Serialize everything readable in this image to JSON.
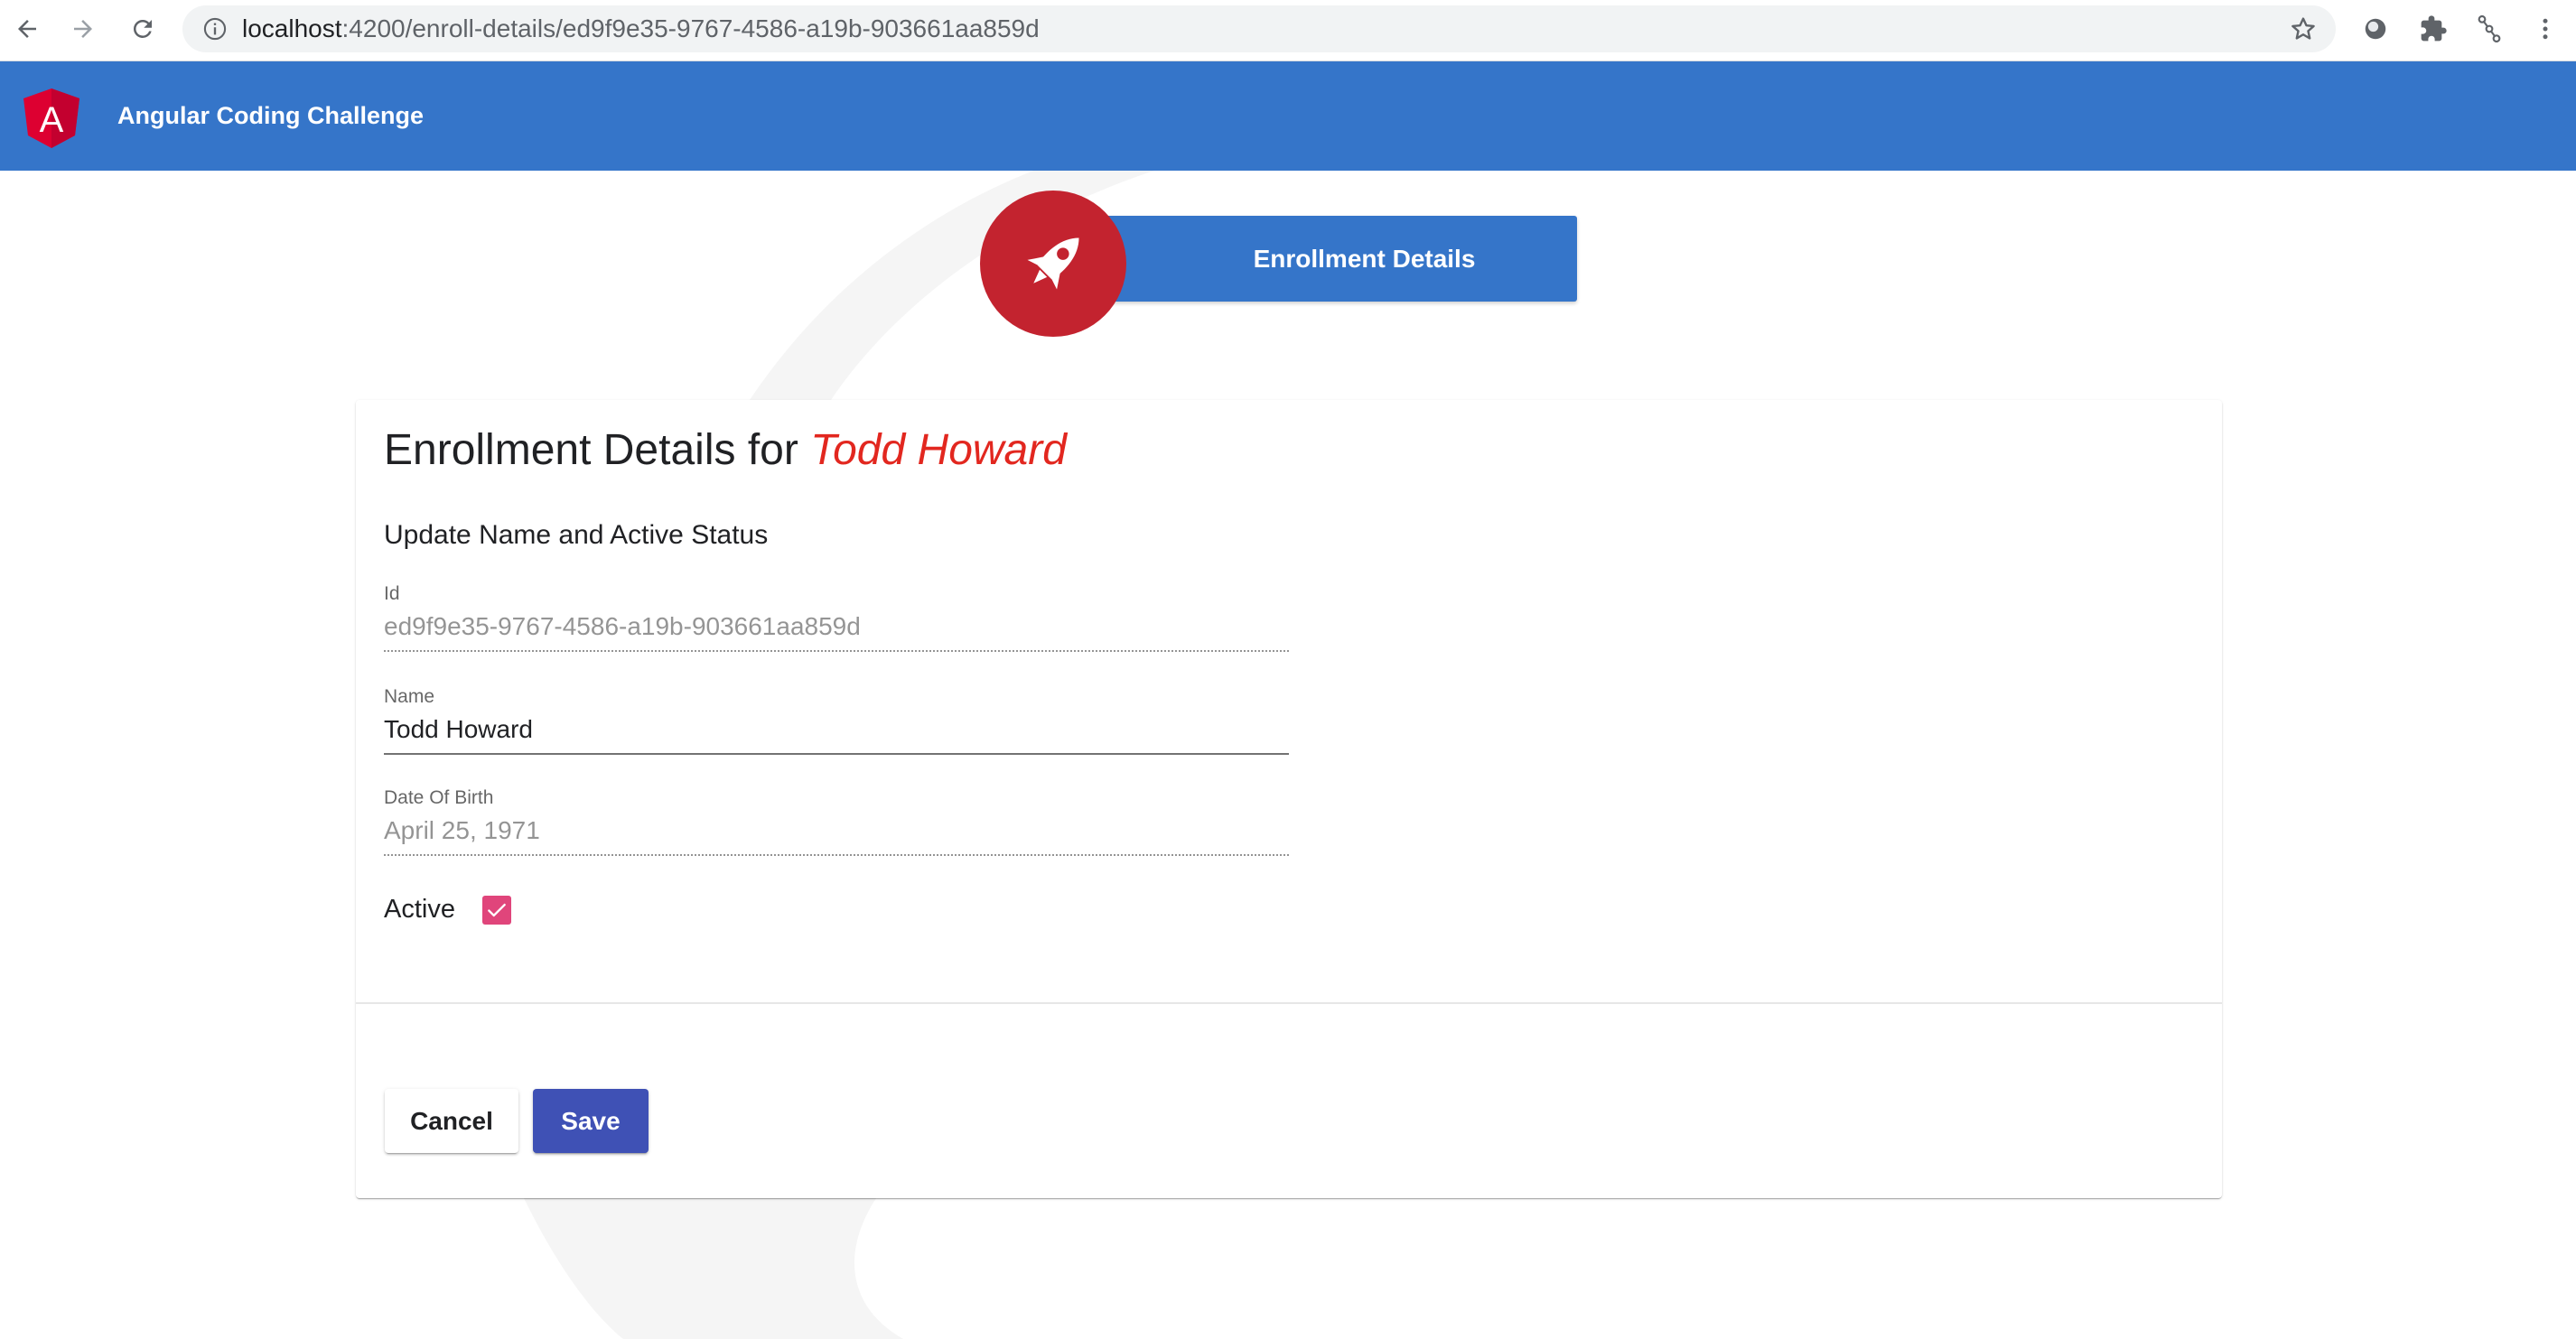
{
  "browser": {
    "url_host": "localhost",
    "url_path": ":4200/enroll-details/ed9f9e35-9767-4586-a19b-903661aa859d",
    "icons": [
      "back-arrow-icon",
      "forward-arrow-icon",
      "reload-icon",
      "info-icon",
      "star-icon",
      "extension-circle-icon",
      "puzzle-icon",
      "extension-link-icon",
      "more-vert-icon"
    ]
  },
  "toolbar": {
    "title": "Angular Coding Challenge",
    "logo_letter": "A",
    "background_color": "#3575c9"
  },
  "hero": {
    "banner_label": "Enrollment Details",
    "icon": "rocket-icon",
    "icon_circle_color": "#c3232f"
  },
  "card": {
    "title_prefix": "Enrollment Details for",
    "title_name": "Todd Howard",
    "subtitle": "Update Name and Active Status",
    "fields": {
      "id": {
        "label": "Id",
        "value": "ed9f9e35-9767-4586-a19b-903661aa859d",
        "disabled": true
      },
      "name": {
        "label": "Name",
        "value": "Todd Howard",
        "disabled": false
      },
      "dob": {
        "label": "Date Of Birth",
        "value": "April 25, 1971",
        "disabled": true
      }
    },
    "active": {
      "label": "Active",
      "checked": true,
      "color": "#e0457b"
    },
    "buttons": {
      "cancel_label": "Cancel",
      "save_label": "Save",
      "save_color": "#3f51b5"
    }
  }
}
